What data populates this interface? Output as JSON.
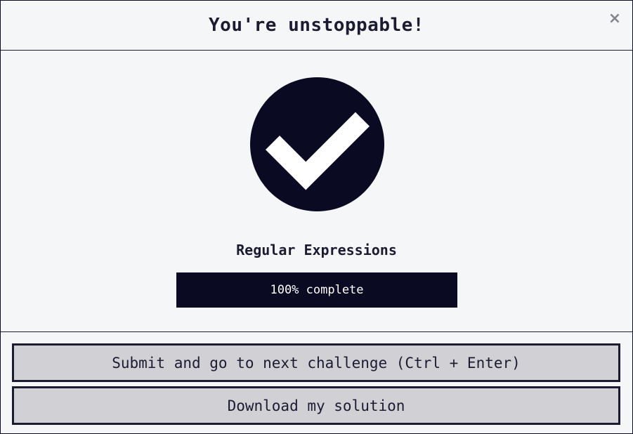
{
  "modal": {
    "title": "You're unstoppable!",
    "close_label": "×"
  },
  "completion": {
    "icon": "check-circle-icon",
    "block_title": "Regular Expressions",
    "progress_label": "100% complete",
    "progress_percent": 100
  },
  "actions": {
    "submit_label": "Submit and go to next challenge (Ctrl + Enter)",
    "download_label": "Download my solution"
  },
  "colors": {
    "dark": "#0a0a23",
    "background": "#f5f6f7",
    "button": "#d0d0d5",
    "close_icon": "#858591"
  }
}
